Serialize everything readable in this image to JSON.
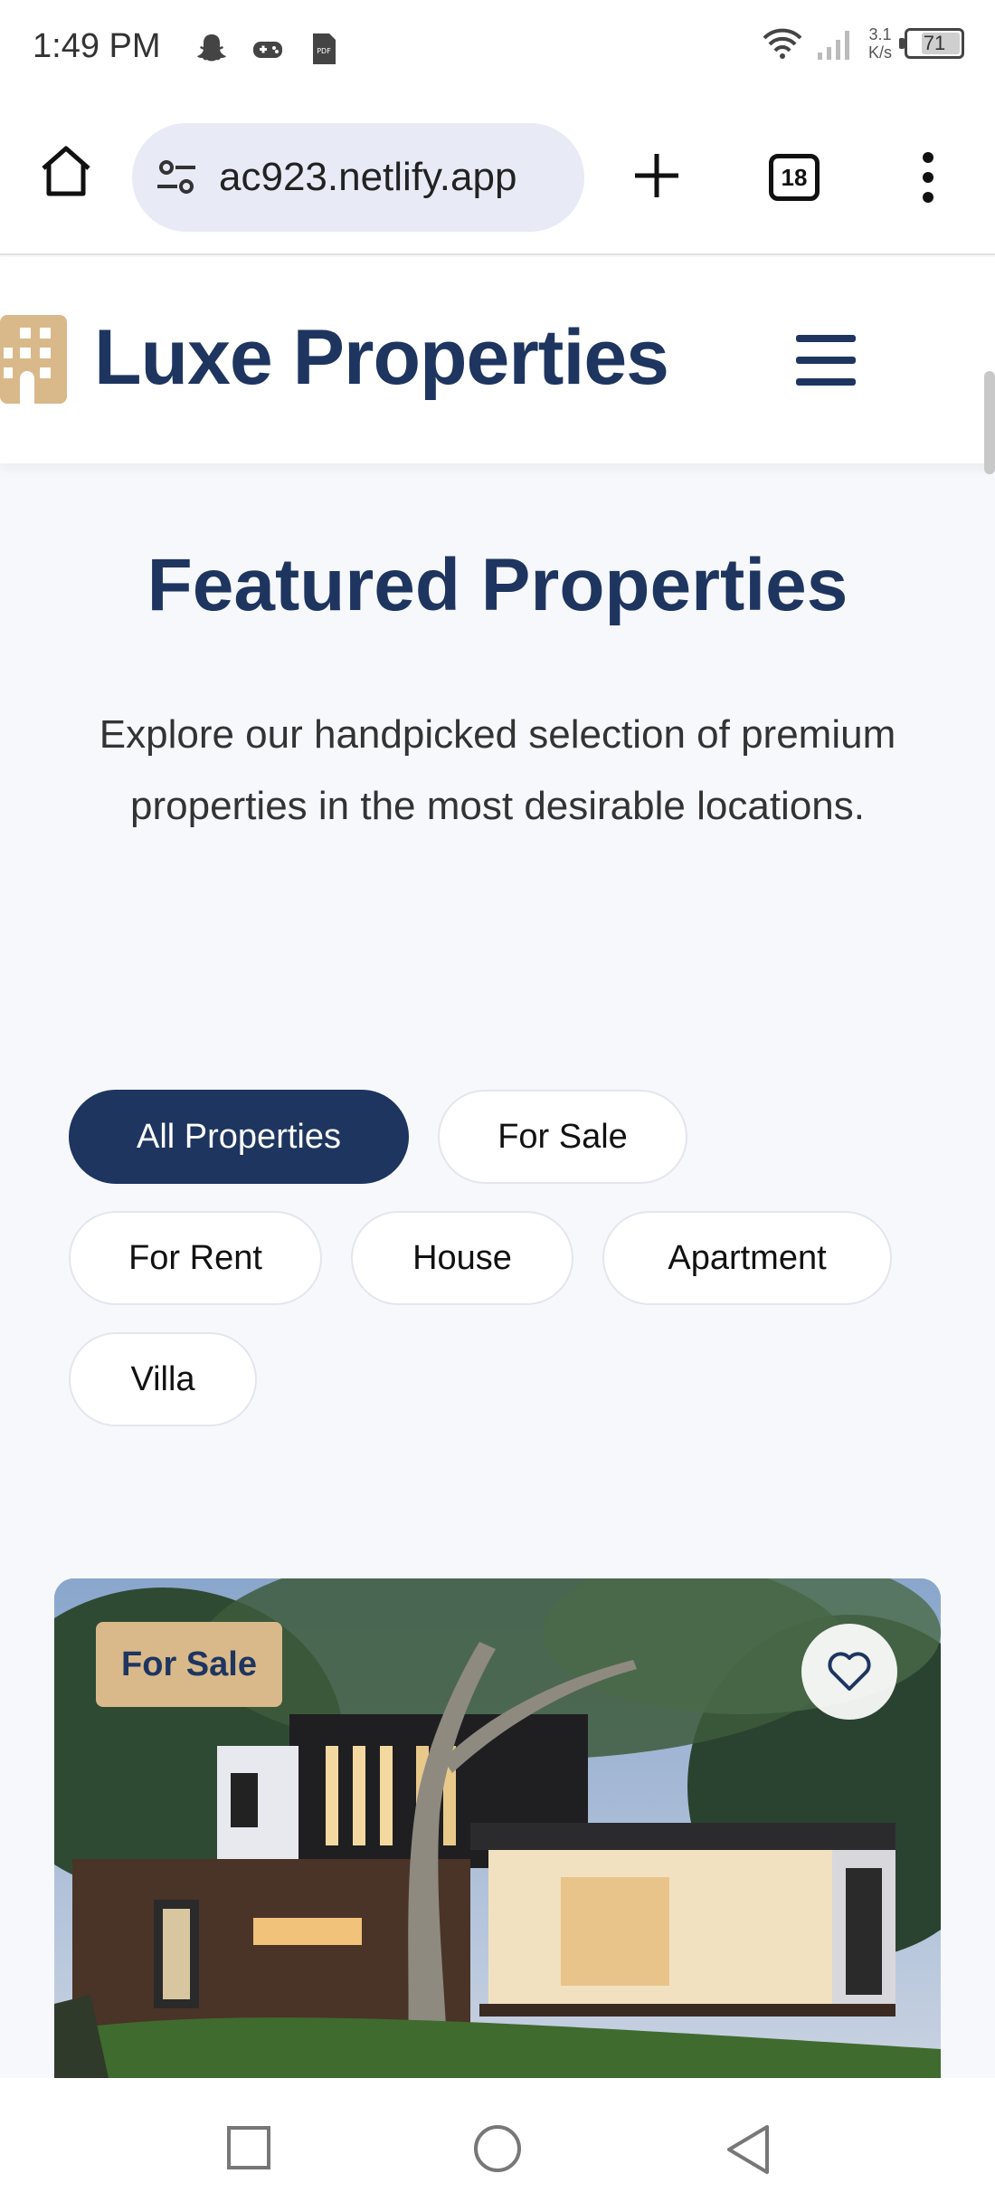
{
  "status_bar": {
    "time": "1:49 PM",
    "net_speed_value": "3.1",
    "net_speed_unit": "K/s",
    "battery": "71",
    "icons": [
      "snapchat-icon",
      "gamepad-icon",
      "pdf-file-icon",
      "wifi-icon",
      "signal-icon",
      "battery-icon"
    ]
  },
  "browser": {
    "url": "ac923.netlify.app",
    "tab_count": "18",
    "icons": [
      "home-icon",
      "site-settings-icon",
      "plus-icon",
      "tabs-icon",
      "more-vert-icon"
    ]
  },
  "header": {
    "brand": "Luxe Properties",
    "icons": [
      "building-icon",
      "hamburger-icon"
    ]
  },
  "main": {
    "title": "Featured Properties",
    "description": "Explore our handpicked selection of premium properties in the most desirable locations.",
    "filters": [
      {
        "label": "All Properties",
        "active": true
      },
      {
        "label": "For Sale",
        "active": false
      },
      {
        "label": "For Rent",
        "active": false
      },
      {
        "label": "House",
        "active": false
      },
      {
        "label": "Apartment",
        "active": false
      },
      {
        "label": "Villa",
        "active": false
      }
    ]
  },
  "property_card": {
    "badge": "For Sale",
    "icons": [
      "heart-icon"
    ]
  },
  "colors": {
    "navy": "#1e3560",
    "gold": "#d9b98a",
    "background": "#f7f8fc"
  },
  "nav_bar": {
    "icons": [
      "recent-apps-icon",
      "home-circle-icon",
      "back-icon"
    ]
  }
}
